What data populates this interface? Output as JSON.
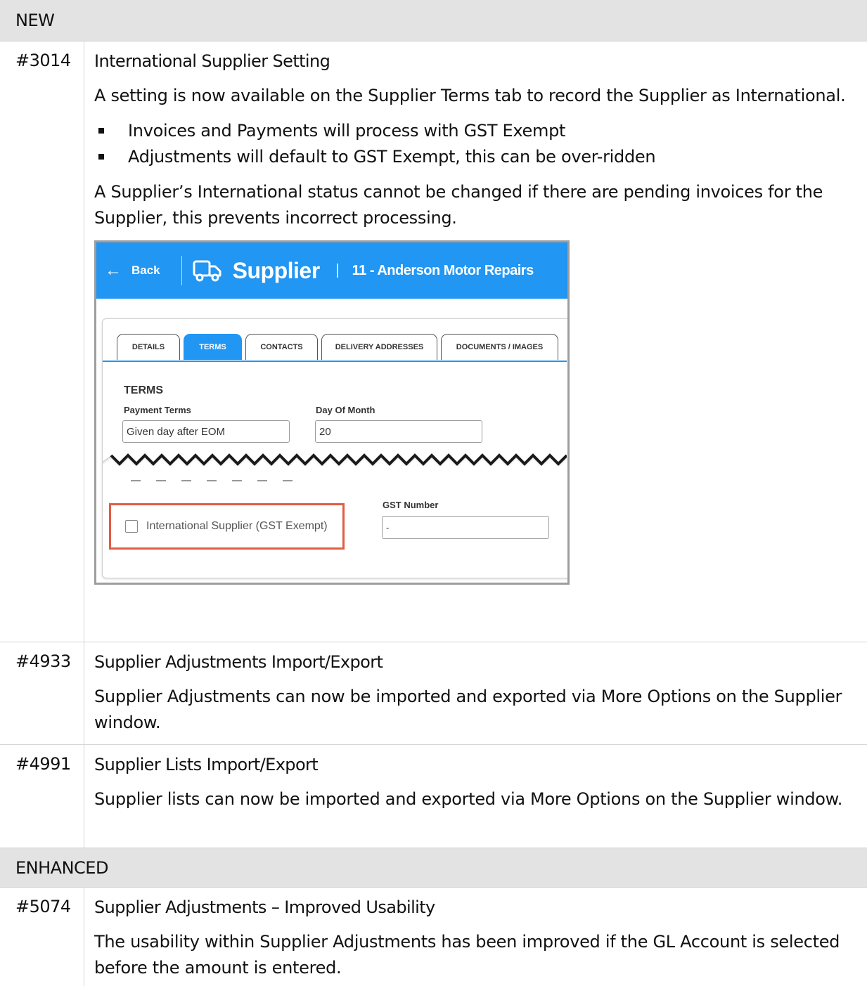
{
  "sections": {
    "new_label": "NEW",
    "enhanced_label": "ENHANCED"
  },
  "items": [
    {
      "id": "#3014",
      "title": "International Supplier Setting",
      "para1": "A setting is now available on the Supplier Terms tab to record the Supplier as International.",
      "bullets": [
        "Invoices and Payments will process with GST Exempt",
        "Adjustments will default to GST Exempt, this can be over-ridden"
      ],
      "para2": "A Supplier’s International status cannot be changed if there are pending invoices for the Supplier, this prevents incorrect processing."
    },
    {
      "id": "#4933",
      "title": "Supplier Adjustments Import/Export",
      "para1": "Supplier Adjustments can now be imported and exported via More Options on the Supplier window."
    },
    {
      "id": "#4991",
      "title": "Supplier Lists Import/Export",
      "para1": "Supplier lists can now be imported and exported via More Options on the Supplier window."
    },
    {
      "id": "#5074",
      "title": "Supplier Adjustments – Improved Usability",
      "para1": "The usability within Supplier Adjustments has been improved if the GL Account is selected before the amount is entered."
    }
  ],
  "screenshot": {
    "back_label": "Back",
    "title": "Supplier",
    "subtitle": "11 - Anderson Motor Repairs",
    "tabs": [
      "DETAILS",
      "TERMS",
      "CONTACTS",
      "DELIVERY ADDRESSES",
      "DOCUMENTS / IMAGES"
    ],
    "active_tab": "TERMS",
    "section_heading": "TERMS",
    "payment_terms_label": "Payment Terms",
    "payment_terms_value": "Given day after EOM",
    "day_of_month_label": "Day Of Month",
    "day_of_month_value": "20",
    "international_checkbox_label": "International Supplier (GST Exempt)",
    "international_checked": false,
    "gst_number_label": "GST Number",
    "gst_number_value": "-",
    "accent_color": "#2196f3",
    "highlight_color": "#e05d44"
  }
}
